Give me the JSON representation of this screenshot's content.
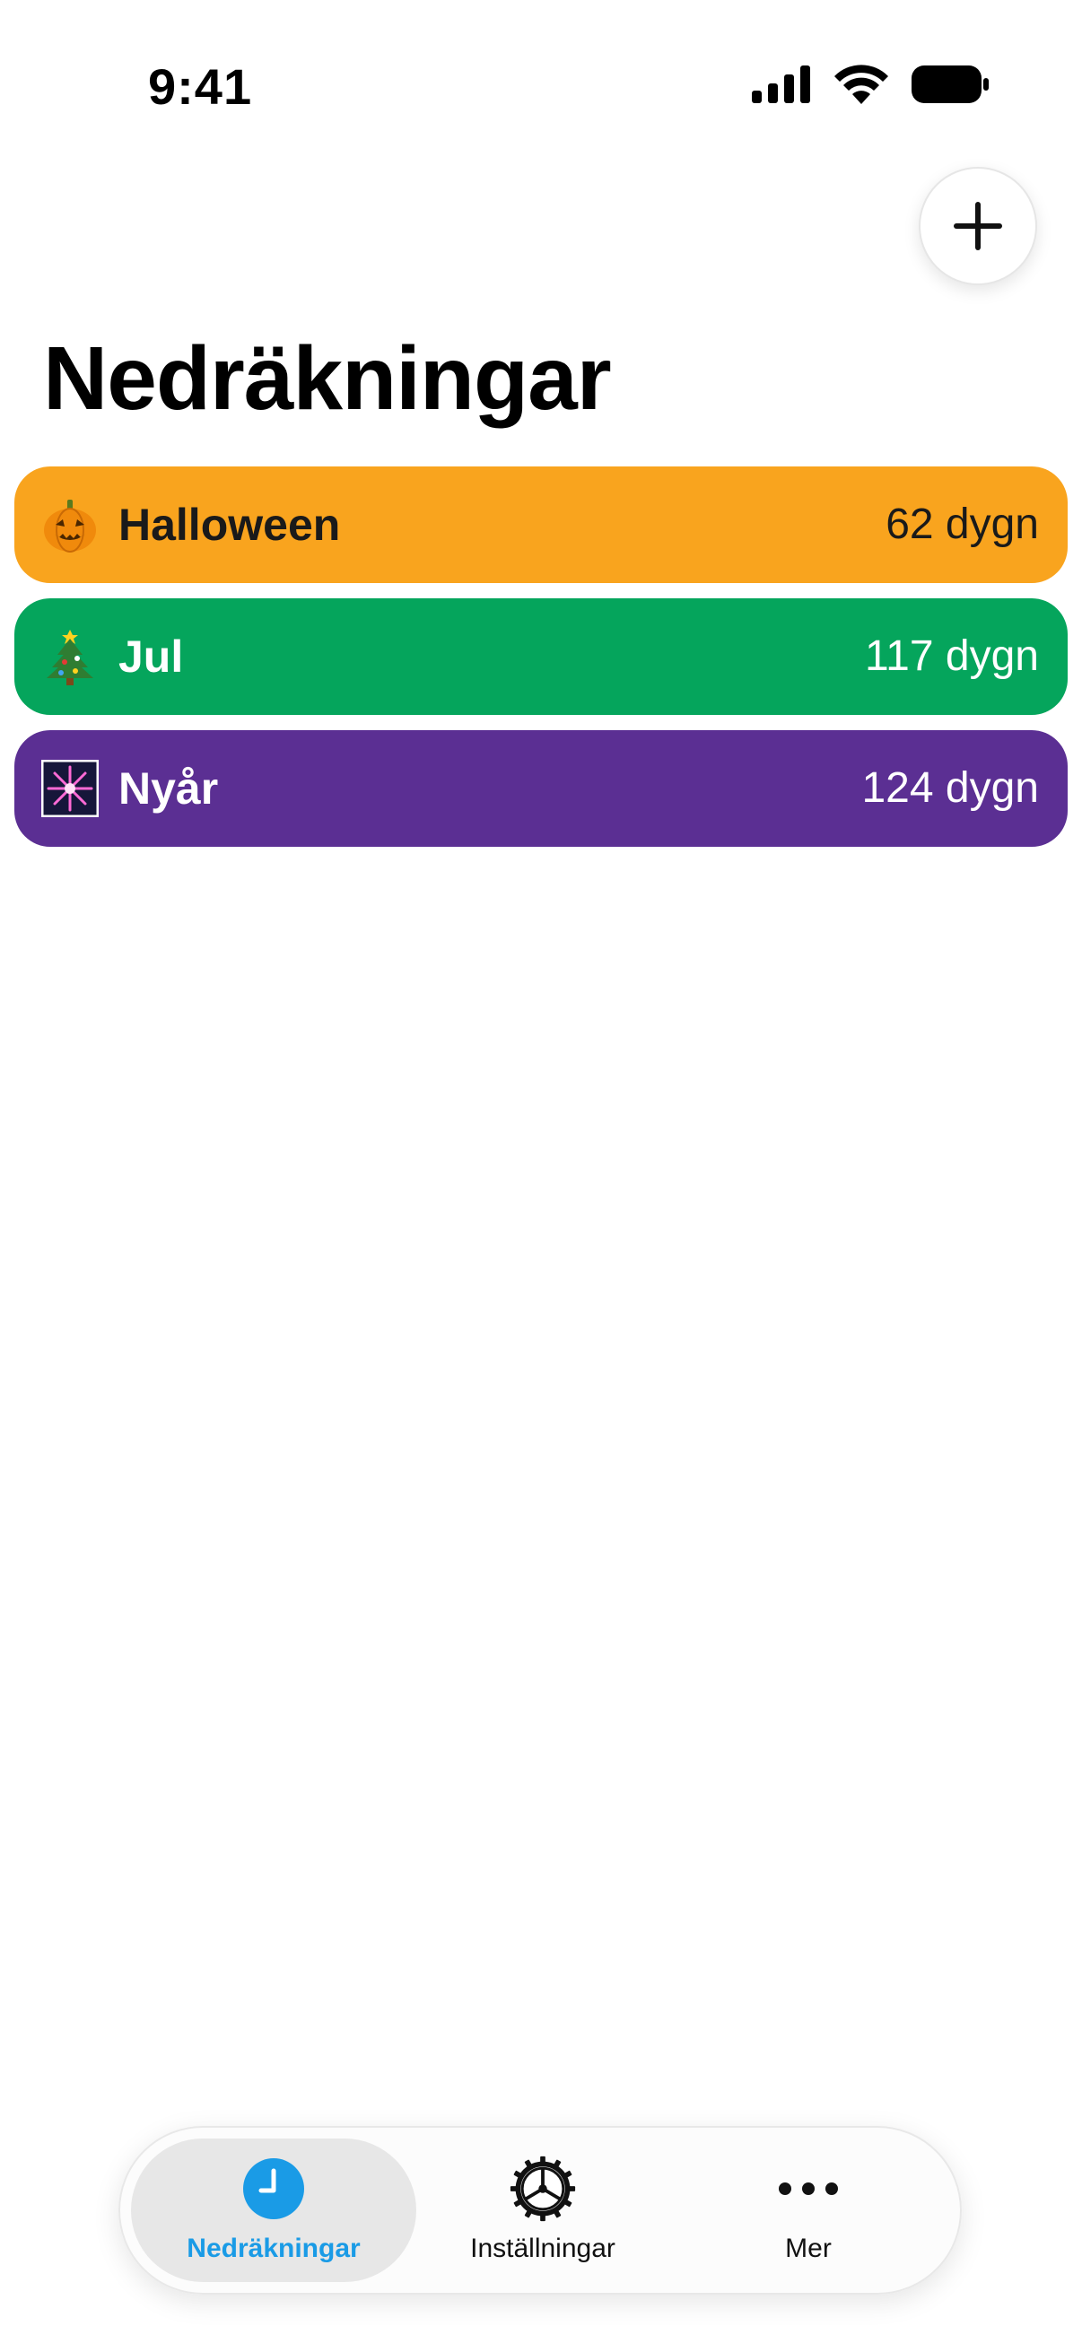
{
  "status_bar": {
    "time": "9:41",
    "icons": [
      "cellular-signal-icon",
      "wifi-icon",
      "battery-icon"
    ]
  },
  "header": {
    "add_icon": "plus-icon",
    "title": "Nedräkningar"
  },
  "countdowns": [
    {
      "name": "Halloween",
      "days": "62 dygn",
      "icon": "jack-o-lantern-icon",
      "color": "#F9A41E",
      "text_color": "#1a1a1a"
    },
    {
      "name": "Jul",
      "days": "117 dygn",
      "icon": "christmas-tree-icon",
      "color": "#05A55C",
      "text_color": "#ffffff"
    },
    {
      "name": "Nyår",
      "days": "124 dygn",
      "icon": "fireworks-icon",
      "color": "#5B2F93",
      "text_color": "#ffffff"
    }
  ],
  "tab_bar": {
    "tabs": [
      {
        "label": "Nedräkningar",
        "icon": "clock-icon",
        "active": true
      },
      {
        "label": "Inställningar",
        "icon": "gear-icon",
        "active": false
      },
      {
        "label": "Mer",
        "icon": "ellipsis-icon",
        "active": false
      }
    ],
    "accent_color": "#1A9BE6"
  }
}
